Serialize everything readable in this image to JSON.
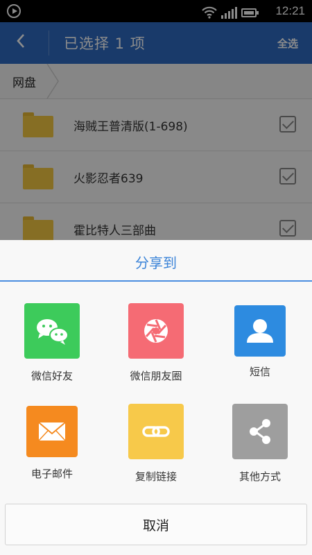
{
  "status_bar": {
    "time": "12:21",
    "icons": [
      "play-icon",
      "wifi-icon",
      "signal-icon",
      "battery-icon"
    ]
  },
  "app_bar": {
    "title": "已选择 1 项",
    "select_all": "全选",
    "back_icon": "chevron-left-icon"
  },
  "breadcrumb": {
    "label": "网盘"
  },
  "files": [
    {
      "name": "海贼王普清版(1-698)"
    },
    {
      "name": "火影忍者639"
    },
    {
      "name": "霍比特人三部曲"
    }
  ],
  "share_sheet": {
    "title": "分享到",
    "options": [
      {
        "label": "微信好友",
        "icon": "wechat-icon",
        "color": "#3dcb5b"
      },
      {
        "label": "微信朋友圈",
        "icon": "wechat-moments-icon",
        "color": "#f56b74"
      },
      {
        "label": "短信",
        "icon": "contact-icon",
        "color": "#2d8be0"
      },
      {
        "label": "电子邮件",
        "icon": "mail-icon",
        "color": "#f58a1f"
      },
      {
        "label": "复制链接",
        "icon": "link-icon",
        "color": "#f7c94a"
      },
      {
        "label": "其他方式",
        "icon": "share-icon",
        "color": "#9e9e9e"
      }
    ],
    "cancel": "取消"
  },
  "colors": {
    "app_bar": "#2f6bc2",
    "accent": "#3a83d8"
  }
}
